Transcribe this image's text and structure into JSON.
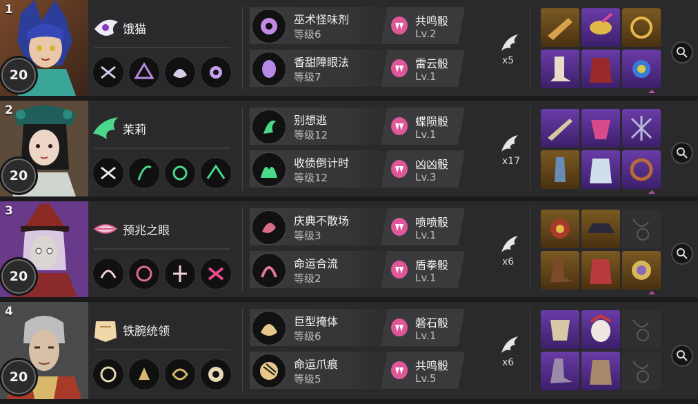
{
  "rows": [
    {
      "rank": "1",
      "name": "饿猫",
      "level": "20",
      "skills": [
        {
          "name": "巫术怪味剂",
          "level": "等级6",
          "dice_name": "共鸣骰",
          "dice_level": "Lv.2"
        },
        {
          "name": "香甜障眼法",
          "level": "等级7",
          "dice_name": "雷云骰",
          "dice_level": "Lv.1"
        }
      ],
      "count": "x5"
    },
    {
      "rank": "2",
      "name": "茉莉",
      "level": "20",
      "skills": [
        {
          "name": "别想逃",
          "level": "等级12",
          "dice_name": "蝶陨骰",
          "dice_level": "Lv.1"
        },
        {
          "name": "收债倒计时",
          "level": "等级12",
          "dice_name": "凶凶骰",
          "dice_level": "Lv.3"
        }
      ],
      "count": "x17"
    },
    {
      "rank": "3",
      "name": "预兆之眼",
      "level": "20",
      "skills": [
        {
          "name": "庆典不散场",
          "level": "等级3",
          "dice_name": "喷喷骰",
          "dice_level": "Lv.1"
        },
        {
          "name": "命运合流",
          "level": "等级2",
          "dice_name": "盾拳骰",
          "dice_level": "Lv.1"
        }
      ],
      "count": "x6"
    },
    {
      "rank": "4",
      "name": "铁腕统领",
      "level": "20",
      "skills": [
        {
          "name": "巨型掩体",
          "level": "等级6",
          "dice_name": "磐石骰",
          "dice_level": "Lv.1"
        },
        {
          "name": "命运爪痕",
          "level": "等级5",
          "dice_name": "共鸣骰",
          "dice_level": "Lv.5"
        }
      ],
      "count": "x6"
    }
  ],
  "colors": {
    "row_bg": "#2a2a2c",
    "epic_item": "#6a3ca8",
    "gold_item": "#7a5a22",
    "dice_pink": "#e0569a"
  },
  "icons": {
    "wing": "wing-emblem-icon",
    "inspect": "magnifier-icon",
    "dice": "fang-dice-icon"
  }
}
